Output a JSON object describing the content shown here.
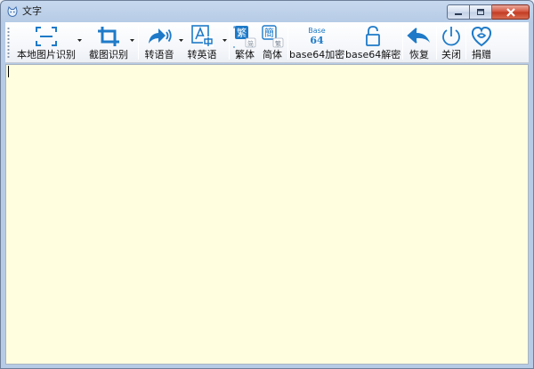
{
  "window": {
    "title": "文字"
  },
  "toolbar": {
    "items": [
      {
        "label": "本地图片识别",
        "icon": "scan-frame-icon"
      },
      {
        "label": "截图识别",
        "icon": "crop-icon"
      },
      {
        "label": "转语音",
        "icon": "share-sound-icon"
      },
      {
        "label": "转英语",
        "icon": "translate-icon"
      },
      {
        "label": "繁体",
        "icon": "traditional-chinese-icon",
        "glyph": "繁",
        "glyph_small": "简"
      },
      {
        "label": "简体",
        "icon": "simplified-chinese-icon",
        "glyph": "簡",
        "glyph_small": "繁"
      },
      {
        "label": "base64加密",
        "icon": "base64-icon",
        "icon_text_top": "Base",
        "icon_text_bottom": "64"
      },
      {
        "label": "base64解密",
        "icon": "unlock-icon"
      },
      {
        "label": "恢复",
        "icon": "undo-all-icon"
      },
      {
        "label": "关闭",
        "icon": "power-icon"
      },
      {
        "label": "捐赠",
        "icon": "donate-heart-icon"
      }
    ]
  },
  "editor": {
    "value": ""
  },
  "colors": {
    "accent": "#1e7ac8",
    "editor_bg": "#ffffe0",
    "close_red": "#c13a22"
  }
}
